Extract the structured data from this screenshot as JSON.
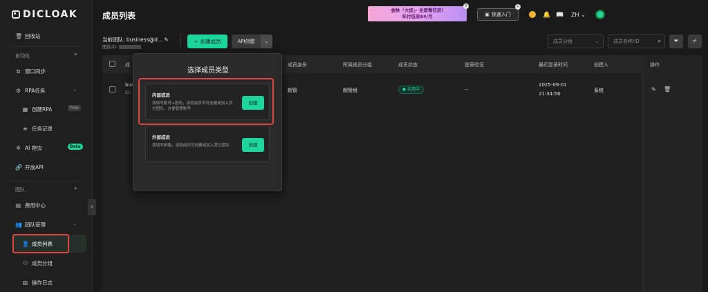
{
  "app": {
    "logo_text": "DICLOAK"
  },
  "sidebar": {
    "recycle": "回收站",
    "section_automation": "自动化",
    "window_sync": "窗口同步",
    "rpa": "RPA任务",
    "create_rpa": "创建RPA",
    "free_badge": "Free",
    "task_log": "任务记录",
    "ai_crawler": "AI 爬虫",
    "beta_badge": "Beta",
    "open_api": "开放API",
    "section_team": "团队",
    "billing": "费用中心",
    "team_mgmt": "团队管理",
    "member_list": "成员列表",
    "member_group": "成员分组",
    "op_log": "操作日志"
  },
  "header": {
    "title": "成员列表",
    "promo_line1": "金秋「大促」· 全套餐狂欢!",
    "promo_line2": "年付低至$4/月",
    "quick_entry": "快速入门",
    "lang": "ZH"
  },
  "toolbar": {
    "team_label": "当前团队: business@d...",
    "team_id_label": "团队ID:",
    "create_member": "创建成员",
    "api_create": "API创建",
    "group_placeholder": "成员分组",
    "search_placeholder": "成员名称/ID"
  },
  "table": {
    "headers": {
      "name": "成",
      "identity": "成员身份",
      "group": "所属成员分组",
      "status": "成员状态",
      "login_verify": "登录验证",
      "last_login": "最近登录时间",
      "creator": "创建人",
      "ops": "操作"
    },
    "rows": [
      {
        "name": "bus",
        "id": "ID:",
        "identity": "超管",
        "group": "超管组",
        "status": "启用中",
        "login_verify": "--",
        "last_login_date": "2025-09-01",
        "last_login_time": "21:34:56",
        "creator": "系统"
      }
    ]
  },
  "popup": {
    "title": "选择成员类型",
    "internal": {
      "title": "内部成员",
      "desc": "须填写账号+密码，该类成员不可创建或加入其它团队，方便管理账号",
      "button": "创建"
    },
    "external": {
      "title": "外部成员",
      "desc": "须填写邮箱，该类成员可创建或加入其它团队",
      "button": "创建"
    }
  },
  "colors": {
    "accent": "#1dd69c",
    "highlight": "#e0473c",
    "background": "#1a1a1a"
  }
}
